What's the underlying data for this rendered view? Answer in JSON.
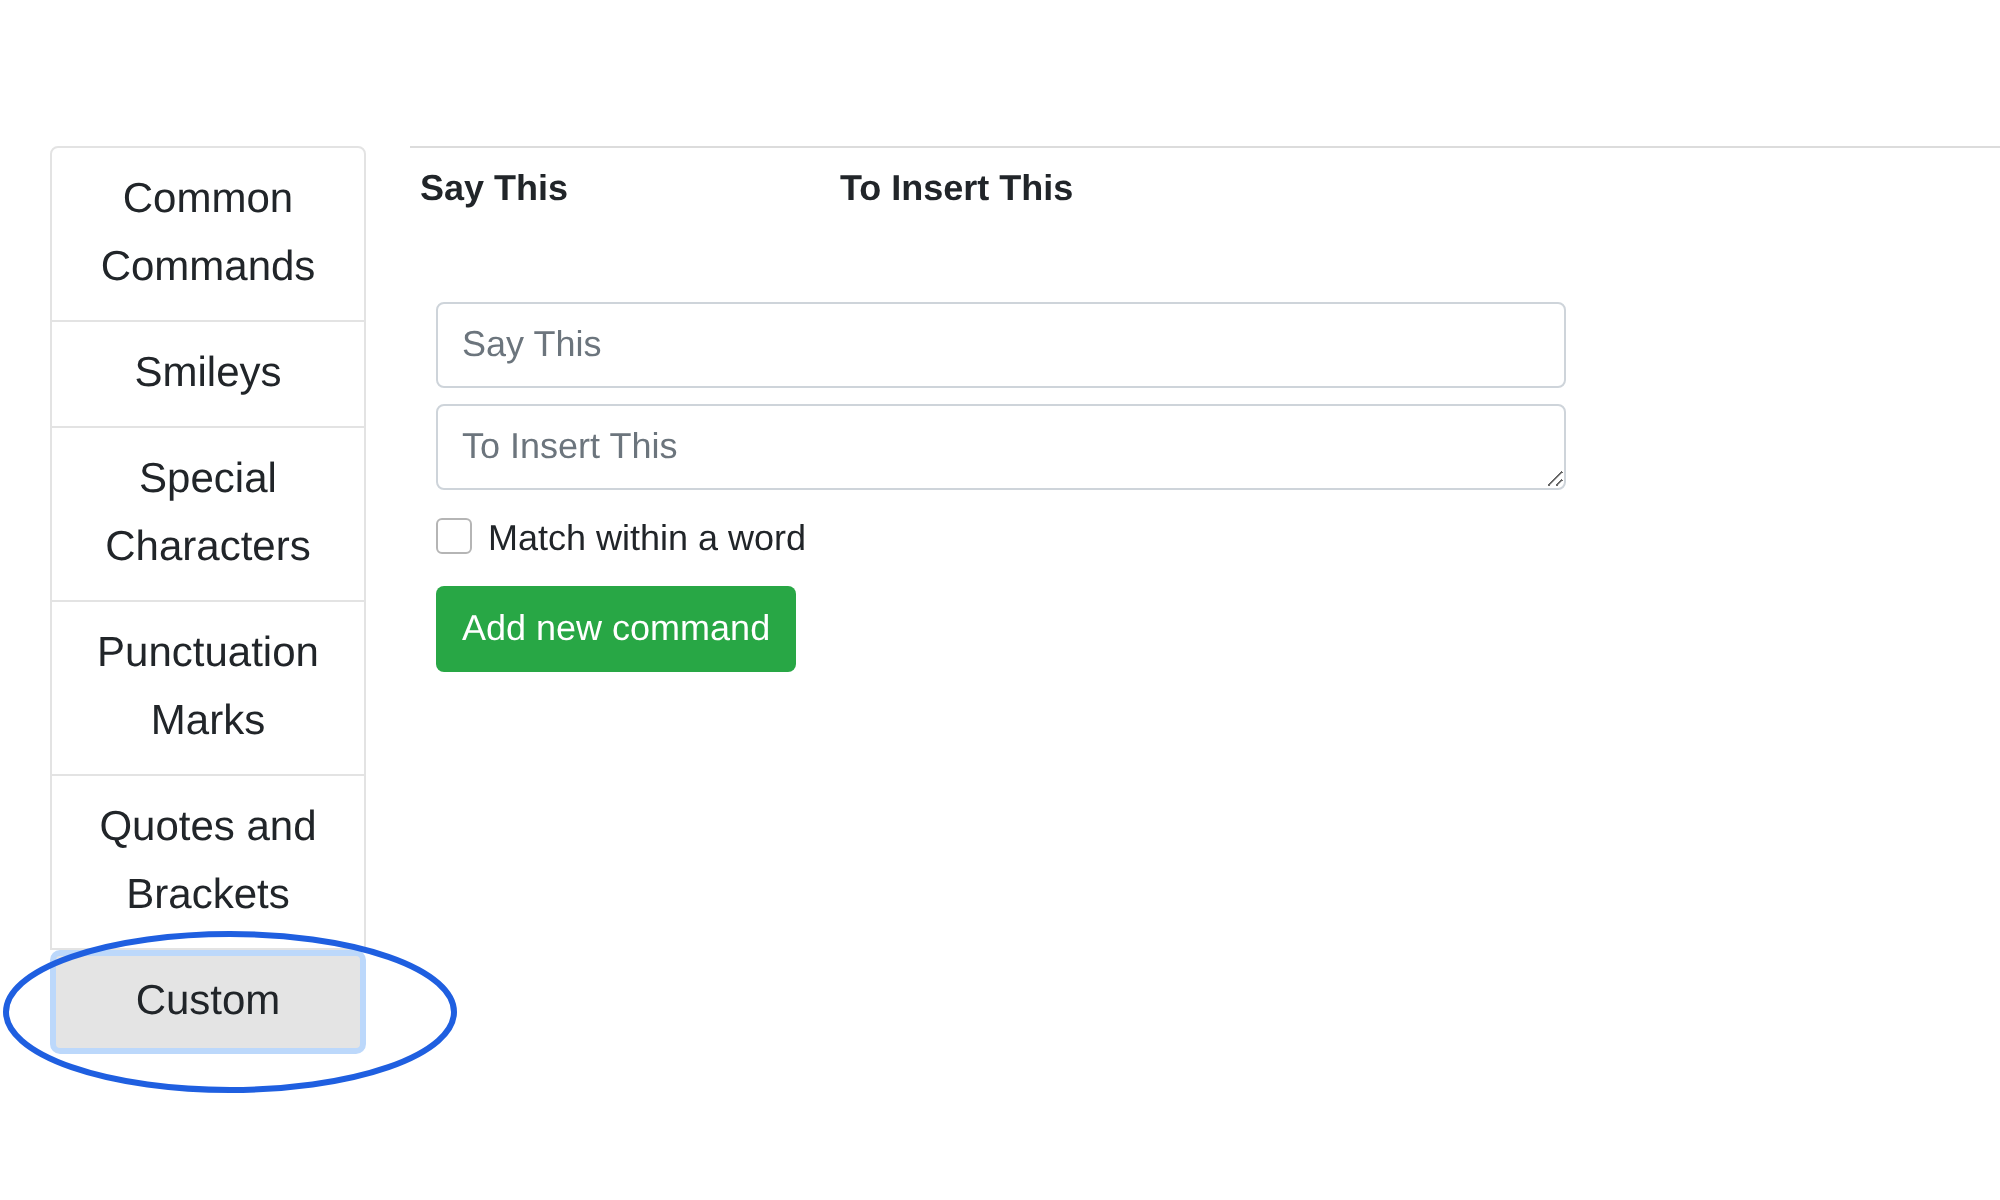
{
  "sidebar": {
    "items": [
      {
        "label": "Common Commands",
        "selected": false
      },
      {
        "label": "Smileys",
        "selected": false
      },
      {
        "label": "Special Characters",
        "selected": false
      },
      {
        "label": "Punctuation Marks",
        "selected": false
      },
      {
        "label": "Quotes and Brackets",
        "selected": false
      },
      {
        "label": "Custom",
        "selected": true
      }
    ]
  },
  "table": {
    "columns": [
      "Say This",
      "To Insert This"
    ]
  },
  "form": {
    "say_field": {
      "placeholder": "Say This"
    },
    "insert_field": {
      "placeholder": "To Insert This"
    },
    "match_within_word": {
      "label": "Match within a word",
      "checked": false
    },
    "button": "Add new command"
  },
  "annotation": {
    "kind": "ellipse"
  }
}
